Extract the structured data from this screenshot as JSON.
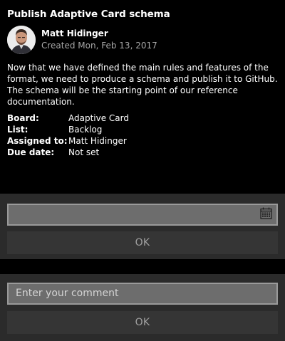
{
  "card": {
    "title": "Publish Adaptive Card schema",
    "author_name": "Matt Hidinger",
    "created": "Created Mon, Feb 13, 2017",
    "description": "Now that we have defined the main rules and features of the format, we need to produce a schema and publish it to GitHub. The schema will be the starting point of our reference documentation.",
    "facts": [
      {
        "key": "Board:",
        "value": "Adaptive Card"
      },
      {
        "key": "List:",
        "value": "Backlog"
      },
      {
        "key": "Assigned to:",
        "value": "Matt Hidinger"
      },
      {
        "key": "Due date:",
        "value": "Not set"
      }
    ]
  },
  "date_panel": {
    "date_value": "",
    "ok_label": "OK"
  },
  "comment_panel": {
    "placeholder": "Enter your comment",
    "ok_label": "OK"
  }
}
